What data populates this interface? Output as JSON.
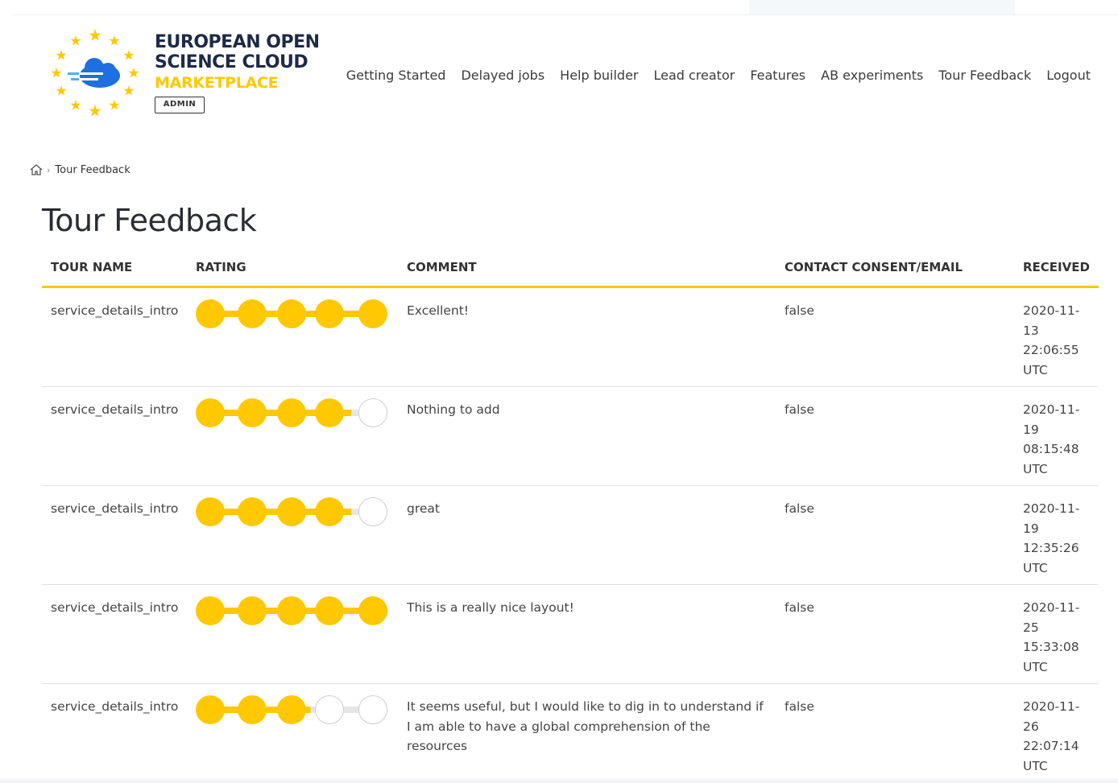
{
  "brand": {
    "title_line1": "EUROPEAN OPEN",
    "title_line2": "SCIENCE CLOUD",
    "subtitle": "MARKETPLACE",
    "badge": "ADMIN",
    "accent": "#ffc800",
    "cloud_color": "#1e6fe0"
  },
  "nav": {
    "items": [
      "Getting Started",
      "Delayed jobs",
      "Help builder",
      "Lead creator",
      "Features",
      "AB experiments",
      "Tour Feedback",
      "Logout"
    ]
  },
  "breadcrumb": {
    "home_icon": "home-icon",
    "current": "Tour Feedback"
  },
  "page": {
    "title": "Tour Feedback"
  },
  "table": {
    "headers": [
      "TOUR NAME",
      "RATING",
      "COMMENT",
      "CONTACT CONSENT/EMAIL",
      "RECEIVED"
    ],
    "rating_max": 5,
    "rating_fill_color": "#ffc800",
    "rating_empty_color": "#e6e6e6",
    "rows": [
      {
        "tour_name": "service_details_intro",
        "rating": 5,
        "comment": "Excellent!",
        "consent": "false",
        "received": "2020-11-13 22:06:55 UTC"
      },
      {
        "tour_name": "service_details_intro",
        "rating": 4,
        "comment": "Nothing to add",
        "consent": "false",
        "received": "2020-11-19 08:15:48 UTC"
      },
      {
        "tour_name": "service_details_intro",
        "rating": 4,
        "comment": "great",
        "consent": "false",
        "received": "2020-11-19 12:35:26 UTC"
      },
      {
        "tour_name": "service_details_intro",
        "rating": 5,
        "comment": "This is a really nice layout!",
        "consent": "false",
        "received": "2020-11-25 15:33:08 UTC"
      },
      {
        "tour_name": "service_details_intro",
        "rating": 3,
        "comment": "It seems useful, but I would like to dig in to understand if I am able to have a global comprehension of the resources",
        "consent": "false",
        "received": "2020-11-26 22:07:14 UTC"
      }
    ]
  }
}
